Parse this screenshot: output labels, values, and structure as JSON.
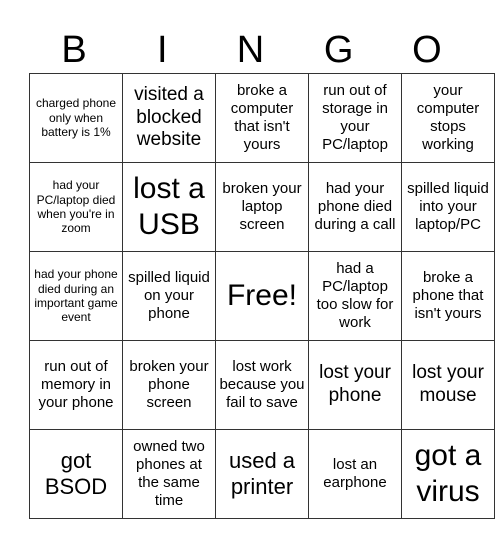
{
  "header": [
    "B",
    "I",
    "N",
    "G",
    "O"
  ],
  "grid": [
    [
      {
        "text": "charged phone only when battery is 1%",
        "size": "xs"
      },
      {
        "text": "visited a blocked website",
        "size": "md"
      },
      {
        "text": "broke a computer that isn't yours",
        "size": "sm"
      },
      {
        "text": "run out of storage in your PC/laptop",
        "size": "sm"
      },
      {
        "text": "your computer stops working",
        "size": "sm"
      }
    ],
    [
      {
        "text": "had your PC/laptop died when you're in zoom",
        "size": "xs"
      },
      {
        "text": "lost a USB",
        "size": "xl"
      },
      {
        "text": "broken your laptop screen",
        "size": "sm"
      },
      {
        "text": "had your phone died during a call",
        "size": "sm"
      },
      {
        "text": "spilled liquid into your laptop/PC",
        "size": "sm"
      }
    ],
    [
      {
        "text": "had your phone died during an important game event",
        "size": "xs"
      },
      {
        "text": "spilled liquid on your phone",
        "size": "sm"
      },
      {
        "text": "Free!",
        "size": "xl"
      },
      {
        "text": "had a PC/laptop too slow for work",
        "size": "sm"
      },
      {
        "text": "broke a phone that isn't yours",
        "size": "sm"
      }
    ],
    [
      {
        "text": "run out of memory in your phone",
        "size": "sm"
      },
      {
        "text": "broken your phone screen",
        "size": "sm"
      },
      {
        "text": "lost work because you fail to save",
        "size": "sm"
      },
      {
        "text": "lost your phone",
        "size": "md"
      },
      {
        "text": "lost your mouse",
        "size": "md"
      }
    ],
    [
      {
        "text": "got BSOD",
        "size": "lg"
      },
      {
        "text": "owned two phones at the same time",
        "size": "sm"
      },
      {
        "text": "used a printer",
        "size": "lg"
      },
      {
        "text": "lost an earphone",
        "size": "sm"
      },
      {
        "text": "got a virus",
        "size": "xl"
      }
    ]
  ]
}
